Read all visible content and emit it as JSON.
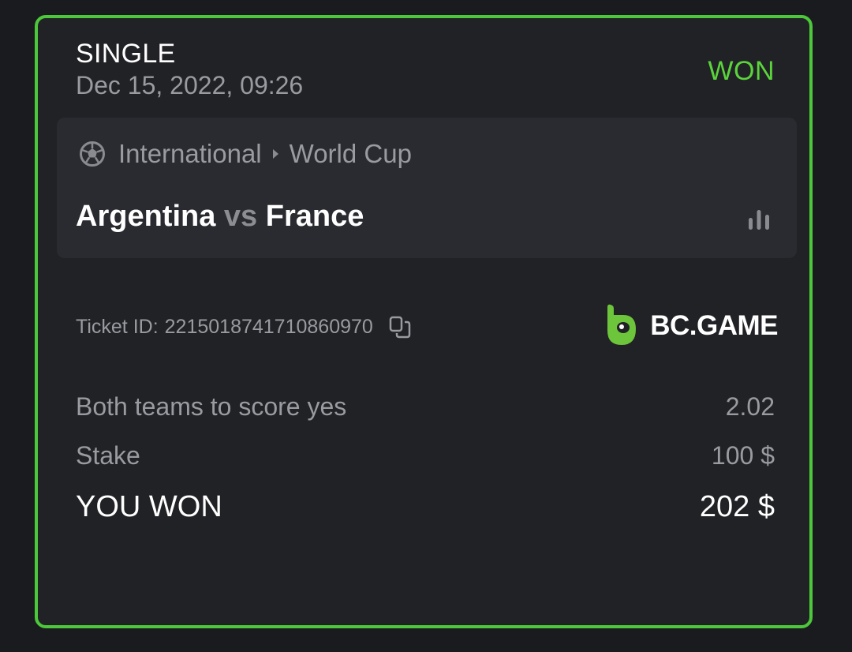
{
  "bet": {
    "type": "SINGLE",
    "date": "Dec 15, 2022, 09:26",
    "status": "WON"
  },
  "event": {
    "icon": "soccer-ball-icon",
    "category": "International",
    "league": "World Cup",
    "home_team": "Argentina",
    "vs_label": "vs",
    "away_team": "France"
  },
  "ticket": {
    "label": "Ticket ID:",
    "id": "2215018741710860970"
  },
  "brand": {
    "name": "BC.GAME"
  },
  "selection": {
    "market": "Both teams to score yes",
    "odds": "2.02"
  },
  "stake": {
    "label": "Stake",
    "value": "100 $"
  },
  "payout": {
    "label": "YOU WON",
    "value": "202 $"
  },
  "colors": {
    "accent": "#4cc83a",
    "status_won": "#5bd43c",
    "card_bg": "#212226",
    "event_bg": "#2a2b30"
  }
}
